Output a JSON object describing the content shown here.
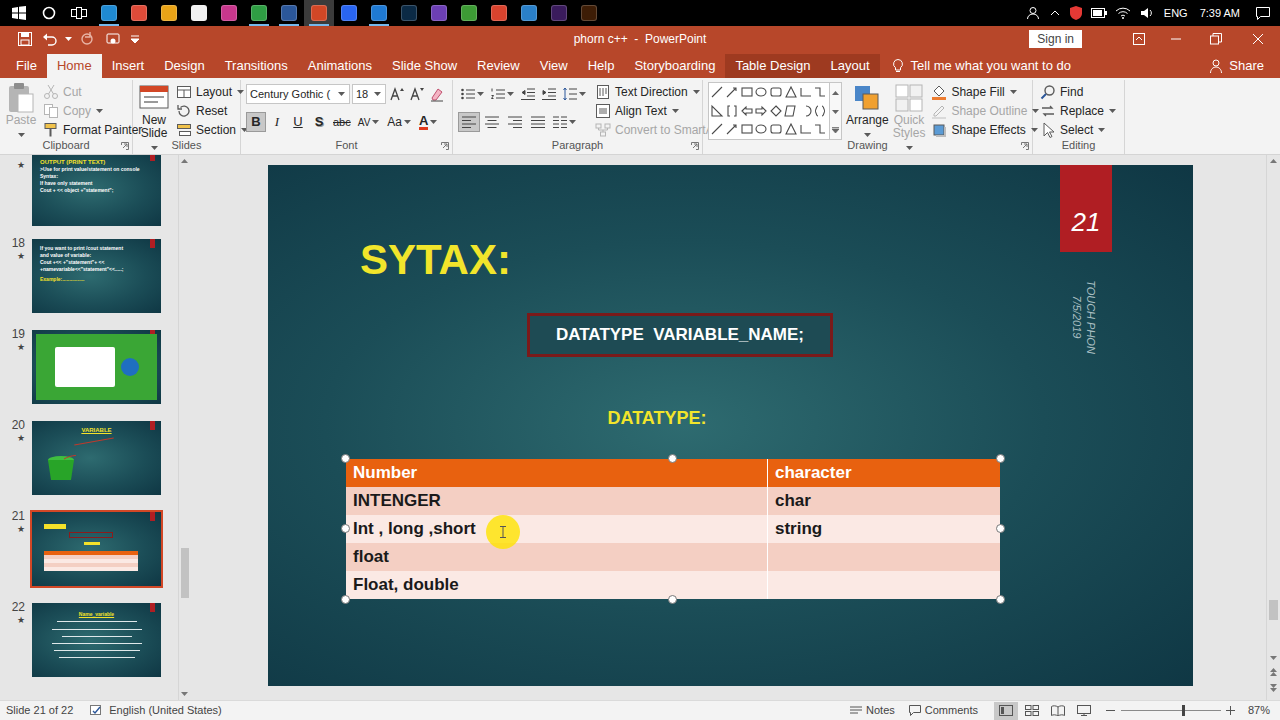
{
  "taskbar": {
    "apps": [
      {
        "color": "#1f8ad2",
        "running": true,
        "selected": false
      },
      {
        "color": "#dd4b39",
        "running": false,
        "selected": false
      },
      {
        "color": "#e8a317",
        "running": false,
        "selected": false
      },
      {
        "color": "#f0f0f0",
        "running": false,
        "selected": false
      },
      {
        "color": "#c7378c",
        "running": false,
        "selected": false
      },
      {
        "color": "#2f9e44",
        "running": true,
        "selected": false
      },
      {
        "color": "#2b579a",
        "running": true,
        "selected": false
      },
      {
        "color": "#d24726",
        "running": true,
        "selected": true
      },
      {
        "color": "#2965f1",
        "running": false,
        "selected": false
      },
      {
        "color": "#1f7ad3",
        "running": true,
        "selected": false
      },
      {
        "color": "#0b2a45",
        "running": false,
        "selected": false
      },
      {
        "color": "#6c3fb4",
        "running": false,
        "selected": false
      },
      {
        "color": "#3d9b35",
        "running": false,
        "selected": false
      },
      {
        "color": "#d8432e",
        "running": false,
        "selected": false
      },
      {
        "color": "#2a80c9",
        "running": false,
        "selected": false
      },
      {
        "color": "#3a1b5c",
        "running": false,
        "selected": false
      },
      {
        "color": "#3d1d06",
        "running": false,
        "selected": false
      }
    ],
    "language": "ENG",
    "time": "7:39 AM"
  },
  "window": {
    "title": "phorn c++  -  PowerPoint",
    "sign_in": "Sign in"
  },
  "ribbon_tabs": [
    {
      "label": "File",
      "selected": false,
      "contextual": false
    },
    {
      "label": "Home",
      "selected": true,
      "contextual": false
    },
    {
      "label": "Insert",
      "selected": false,
      "contextual": false
    },
    {
      "label": "Design",
      "selected": false,
      "contextual": false
    },
    {
      "label": "Transitions",
      "selected": false,
      "contextual": false
    },
    {
      "label": "Animations",
      "selected": false,
      "contextual": false
    },
    {
      "label": "Slide Show",
      "selected": false,
      "contextual": false
    },
    {
      "label": "Review",
      "selected": false,
      "contextual": false
    },
    {
      "label": "View",
      "selected": false,
      "contextual": false
    },
    {
      "label": "Help",
      "selected": false,
      "contextual": false
    },
    {
      "label": "Storyboarding",
      "selected": false,
      "contextual": false
    },
    {
      "label": "Table Design",
      "selected": false,
      "contextual": true
    },
    {
      "label": "Layout",
      "selected": false,
      "contextual": true
    }
  ],
  "tell_me": "Tell me what you want to do",
  "share": "Share",
  "ribbon": {
    "clipboard": {
      "label": "Clipboard",
      "paste": {
        "label": "Paste",
        "disabled": true
      },
      "cut": {
        "label": "Cut",
        "disabled": true
      },
      "copy": {
        "label": "Copy",
        "disabled": true
      },
      "format_painter": {
        "label": "Format Painter",
        "disabled": false
      }
    },
    "slides": {
      "label": "Slides",
      "new_slide": "New Slide",
      "layout": "Layout",
      "reset": "Reset",
      "section": "Section"
    },
    "font": {
      "label": "Font",
      "family": "Century Gothic (",
      "size": "18",
      "buttons": [
        {
          "label": "B",
          "kind": "bold",
          "selected": true
        },
        {
          "label": "I",
          "kind": "italic",
          "selected": false
        },
        {
          "label": "U",
          "kind": "underline",
          "selected": false
        },
        {
          "label": "S",
          "kind": "shadow",
          "selected": false
        },
        {
          "label": "abc",
          "kind": "strike",
          "selected": false
        },
        {
          "label": "AV",
          "kind": "spacing",
          "selected": false
        },
        {
          "label": "Aa",
          "kind": "case",
          "selected": false
        },
        {
          "label": "A",
          "kind": "color",
          "selected": false
        }
      ]
    },
    "paragraph": {
      "label": "Paragraph",
      "alignments": [
        {
          "selected": true
        },
        {
          "selected": false
        },
        {
          "selected": false
        },
        {
          "selected": false
        }
      ],
      "text_direction": "Text Direction",
      "align_text": "Align Text",
      "smartart": {
        "label": "Convert to SmartArt",
        "disabled": true
      }
    },
    "drawing": {
      "label": "Drawing",
      "arrange": "Arrange",
      "quick_styles": {
        "label": "Quick Styles",
        "disabled": true
      },
      "shape_fill": {
        "label": "Shape Fill",
        "disabled": false
      },
      "shape_outline": {
        "label": "Shape Outline",
        "disabled": true
      },
      "shape_effects": {
        "label": "Shape Effects",
        "disabled": false
      }
    },
    "editing": {
      "label": "Editing",
      "find": "Find",
      "replace": "Replace",
      "select": "Select"
    }
  },
  "thumbnails": [
    {
      "star": "★",
      "selected": false,
      "kind": "text",
      "title": "OUTPUT (PRINT TEXT)",
      "lines": [
        ">Use for print value/statement on console",
        "Syntax:",
        "If have only statement",
        "Cout + << object +\"statement\";"
      ]
    },
    {
      "number": "18",
      "star": "★",
      "selected": false,
      "kind": "text",
      "lines": [
        "If you want to print /cout statement",
        "and value of variable:",
        "Cout +<< +\"statement\"+ <<",
        "+namevariable<<\"statement\"<<.....;"
      ],
      "note": "Example:................"
    },
    {
      "number": "19",
      "star": "★",
      "selected": false,
      "kind": "image"
    },
    {
      "number": "20",
      "star": "★",
      "selected": false,
      "kind": "bucket",
      "title": "VARIABLE"
    },
    {
      "number": "21",
      "star": "★",
      "selected": true,
      "kind": "mini"
    },
    {
      "number": "22",
      "star": "★",
      "selected": false,
      "kind": "bullets",
      "title": "Name_variable"
    }
  ],
  "slide": {
    "heading": "SYTAX:",
    "number": "21",
    "footer_name": "TOUCH PHON",
    "footer_date": "7/5/2019",
    "syntax": "DATATYPE  VARIABLE_NAME;",
    "datatype_label": "DATATYPE:",
    "table": {
      "columns": [
        "Number",
        "character"
      ],
      "rows": [
        [
          "INTENGER",
          "char"
        ],
        [
          "Int , long ,short",
          "string"
        ],
        [
          "float",
          ""
        ],
        [
          "Float, double",
          ""
        ]
      ]
    }
  },
  "status_bar": {
    "slide": "Slide 21 of 22",
    "language": "English (United States)",
    "notes": "Notes",
    "comments": "Comments",
    "views": [
      {
        "selected": true
      },
      {
        "selected": false
      },
      {
        "selected": false
      },
      {
        "selected": false
      }
    ],
    "zoom_level": 0.62,
    "zoom": "87%"
  }
}
